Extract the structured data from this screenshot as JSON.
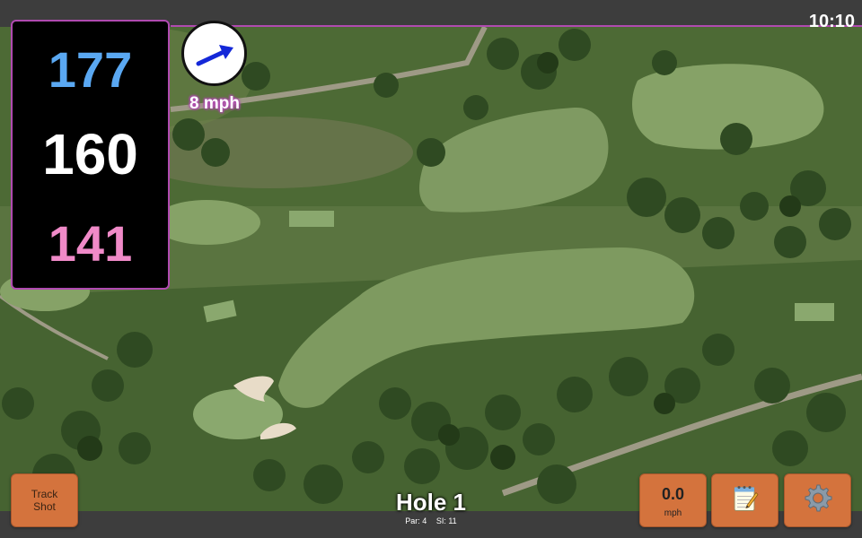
{
  "status": {
    "clock": "10:10"
  },
  "distances": {
    "back": "177",
    "middle": "160",
    "front": "141"
  },
  "wind": {
    "speed_label": "8 mph",
    "direction_icon": "arrow-icon"
  },
  "hole": {
    "title": "Hole 1",
    "par_label": "Par: 4",
    "si_label": "SI: 11"
  },
  "buttons": {
    "track_shot_line1": "Track",
    "track_shot_line2": "Shot",
    "speed_value": "0.0",
    "speed_unit": "mph",
    "notes_icon": "notepad-icon",
    "settings_icon": "gear-icon"
  },
  "colors": {
    "back_distance": "#5aa8f2",
    "middle_distance": "#ffffff",
    "front_distance": "#f08ac8",
    "accent": "#b04ab0",
    "button": "#d4733d"
  }
}
